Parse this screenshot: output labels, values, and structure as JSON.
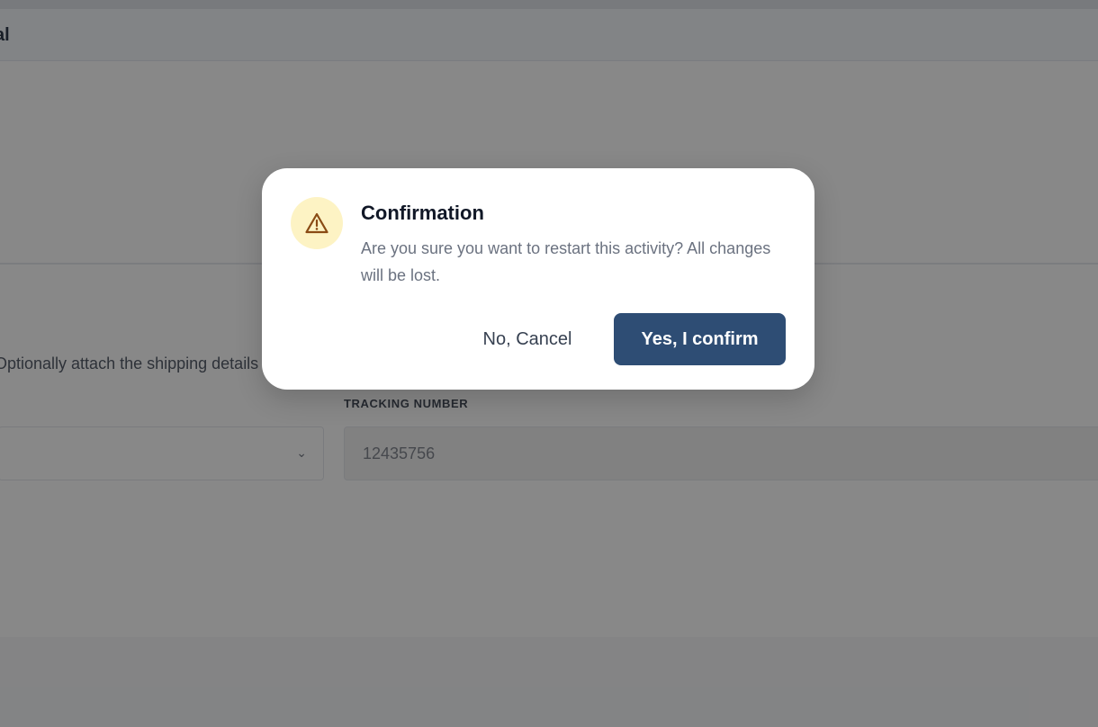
{
  "background": {
    "header_title": "al",
    "instruction_text": "Optionally attach the shipping details",
    "tracking_label": "TRACKING NUMBER",
    "tracking_value": "12435756",
    "carrier_chevron": "chevron-down-icon"
  },
  "dialog": {
    "icon": "warning-triangle-icon",
    "title": "Confirmation",
    "message": "Are you sure you want to restart this activity? All changes will be lost.",
    "cancel_label": "No, Cancel",
    "confirm_label": "Yes, I confirm"
  },
  "colors": {
    "primary": "#2e4d74",
    "warning_bg": "#fdf3c4",
    "warning_icon": "#8a4b14",
    "overlay": "rgba(17,17,17,0.5)"
  }
}
